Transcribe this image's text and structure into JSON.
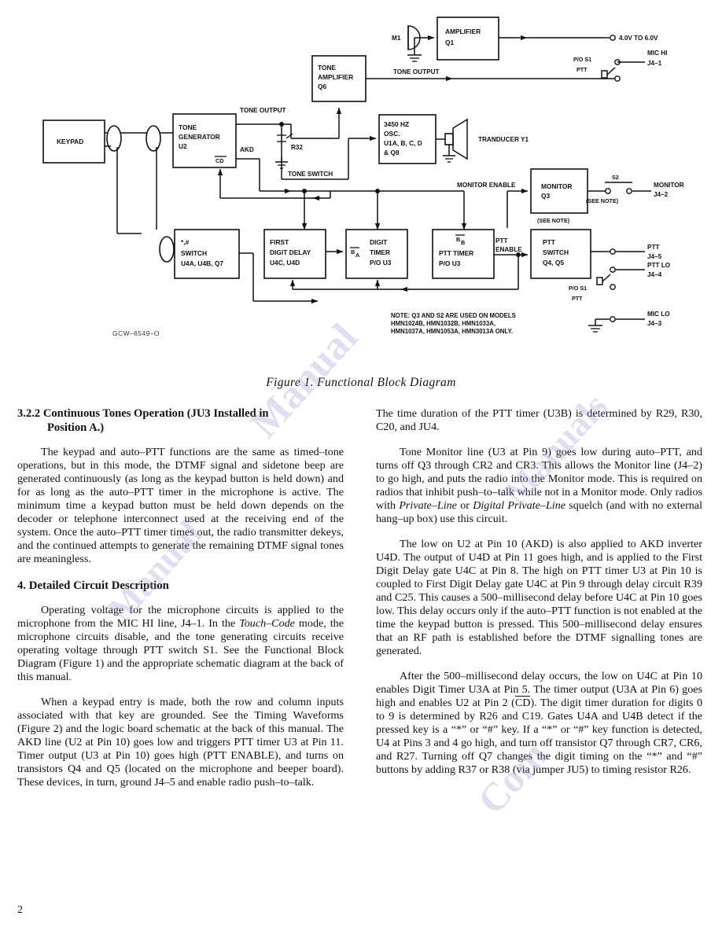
{
  "page": {
    "number": "2",
    "figure_caption": "Figure 1.  Functional Block Diagram",
    "drawing_number": "GCW–6549–O",
    "ghost_top_left": "",
    "ghost_top_right": ""
  },
  "watermark": {
    "w1": "Manual",
    "w2": "Manuals",
    "w3": "Manual",
    "w4": "Com"
  },
  "diagram": {
    "blocks": {
      "keypad": "KEYPAD",
      "tone_generator": [
        "TONE",
        "GENERATOR",
        "U2"
      ],
      "amplifier": [
        "AMPLIFIER",
        "Q1"
      ],
      "tone_amplifier": [
        "TONE",
        "AMPLIFIER",
        "Q6"
      ],
      "oscillator": [
        "3450 HZ",
        "OSC.",
        "U1A, B, C, D",
        "& Q8"
      ],
      "monitor": [
        "MONITOR",
        "Q3"
      ],
      "star_pound_switch": [
        "SWITCH",
        "U4A, U4B, Q7"
      ],
      "star_pound_symbols": "*,#",
      "first_digit_delay": [
        "FIRST",
        "DIGIT DELAY",
        "U4C, U4D"
      ],
      "digit_timer": [
        "DIGIT",
        "TIMER",
        "P/O U3"
      ],
      "ptt_timer": [
        "PTT TIMER",
        "P/O U3"
      ],
      "ptt_switch": [
        "PTT",
        "SWITCH",
        "Q4, Q5"
      ]
    },
    "labels": {
      "mic_element": "M1",
      "supply_voltage": "4.0V TO 6.0V",
      "tone_output_top": "TONE OUTPUT",
      "tone_output_left": "TONE OUTPUT",
      "akd": "AKD",
      "cd_bar": "CD",
      "r32": "R32",
      "tone_switch": "TONE SWITCH",
      "transducer": "TRANDUCER Y1",
      "monitor_enable": "MONITOR ENABLE",
      "ptt_enable_1": "PTT",
      "ptt_enable_2": "ENABLE",
      "b_bar_a_1": "B",
      "b_bar_a_2": "A",
      "b_bar_b_1": "B",
      "b_bar_b_2": "B",
      "see_note_switch": "(SEE NOTE)",
      "see_note_block": "(SEE NOTE)",
      "s2": "S2",
      "po_s1_top_1": "P/O S1",
      "po_s1_top_2": "PTT",
      "po_s1_bot_1": "P/O S1",
      "po_s1_bot_2": "PTT"
    },
    "connectors": {
      "mic_hi": [
        "MIC HI",
        "J4–1"
      ],
      "monitor": [
        "MONITOR",
        "J4–2"
      ],
      "mic_lo": [
        "MIC LO",
        "J4–3"
      ],
      "ptt_lo": [
        "PTT LO",
        "J4–4"
      ],
      "ptt": [
        "PTT",
        "J4–5"
      ]
    },
    "note": [
      "NOTE: Q3 AND S2 ARE USED ON MODELS",
      "HMN1024B, HMN1032B, HMN1033A,",
      "HMN1037A, HMN1053A, HMN3013A ONLY."
    ]
  },
  "left_column": {
    "heading_number": "3.2.2",
    "heading_line1": "Continuous Tones Operation (JU3 Installed in",
    "heading_line2": "Position A.)",
    "para1": "The keypad and auto–PTT functions are the same as timed–tone operations, but in this mode, the DTMF signal and sidetone beep are generated continuously (as long as the keypad button is held down) and for as long as the auto–PTT timer in the microphone is active. The minimum time a keypad button must be held down depends on the decoder or telephone interconnect used at the receiving end of the system. Once the auto–PTT timer times out, the radio transmitter dekeys, and the continued attempts to generate the remaining DTMF signal tones are meaningless.",
    "section4_heading": "4.  Detailed Circuit Description",
    "para2_a": "Operating voltage for the microphone circuits is applied to the microphone from the MIC HI line, J4–1. In the ",
    "para2_ital": "Touch–Code",
    "para2_b": " mode, the microphone circuits disable, and the tone generating circuits receive operating voltage through PTT switch S1. See the Functional Block Diagram (Figure 1) and the appropriate schematic diagram at the back of this manual.",
    "para3": "When a keypad entry is made, both the row and column inputs associated with that key are grounded. See the Timing Waveforms (Figure 2) and the logic board schematic at the back of this manual. The AKD line (U2 at Pin 10) goes low and triggers PTT timer U3 at Pin 11. Timer output (U3 at Pin 10) goes high (PTT  ENABLE), and turns on transistors Q4 and Q5 (located on the microphone and beeper board). These devices, in turn, ground J4–5 and enable radio push–to–talk."
  },
  "right_column": {
    "para1": "The time duration of the PTT timer (U3B) is determined by R29, R30, C20, and JU4.",
    "para2_a": "Tone Monitor line (U3 at Pin 9) goes low during auto–PTT, and turns off Q3 through CR2 and CR3. This allows the Monitor line (J4–2) to go high, and puts the radio into the Monitor mode. This is required on radios that inhibit push–to–talk while not in a Monitor mode. Only radios with ",
    "para2_ital1": "Private–Line",
    "para2_mid": " or ",
    "para2_ital2": "Digital Private–Line",
    "para2_b": " squelch (and with no external hang–up box) use this circuit.",
    "para3": "The low on U2 at Pin 10 (AKD) is also applied to AKD inverter U4D. The output of U4D at Pin 11 goes high, and is applied to the First Digit Delay gate U4C at Pin 8. The high on PTT timer U3 at Pin 10 is coupled to First Digit Delay gate U4C at Pin 9 through delay circuit R39 and C25. This causes a 500–millisecond delay before U4C at Pin 10 goes low. This delay occurs only if the auto–PTT function is not enabled at the time the keypad button is pressed. This 500–millisecond delay ensures that an RF path is established before the DTMF signalling tones are generated.",
    "para4_a": "After the 500–millisecond delay occurs, the low on U4C at Pin 10 enables Digit Timer U3A at Pin 5. The timer output (U3A at Pin 6) goes high and enables U2 at Pin 2 (",
    "para4_cd": "CD",
    "para4_b": "). The digit timer duration for digits 0 to 9 is determined by R26 and C19. Gates U4A and U4B detect if the pressed key is a “*” or “#” key. If a “*” or “#” key function is detected, U4 at Pins 3 and 4 go high, and turn off transistor Q7 through CR7, CR6, and R27. Turning off Q7 changes the digit timing on the “*” and “#” buttons by adding R37 or R38 (via jumper JU5) to timing resistor R26."
  }
}
